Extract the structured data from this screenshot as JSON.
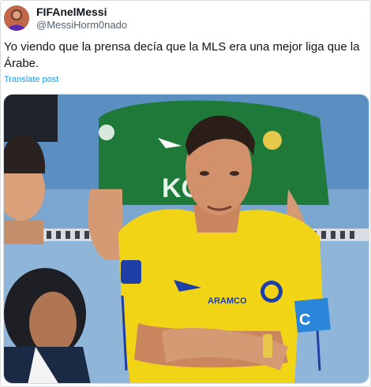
{
  "author": {
    "display_name": "FIFAnelMessi",
    "handle": "@MessiHorm0nado",
    "avatar_icon": "avatar-photo"
  },
  "post": {
    "text": "Yo viendo que la prensa decía que la MLS era una mejor liga que la Árabe.",
    "translate_label": "Translate post"
  },
  "media": {
    "description_icon": "photo",
    "jersey_text": "ARAMCO",
    "sleeve_text": "KO",
    "armband_text": "C"
  },
  "colors": {
    "link": "#1d9bf0",
    "handle": "#536471",
    "text": "#0f1419",
    "jersey_yellow": "#f2d417",
    "jersey_green": "#1f7a3a"
  }
}
